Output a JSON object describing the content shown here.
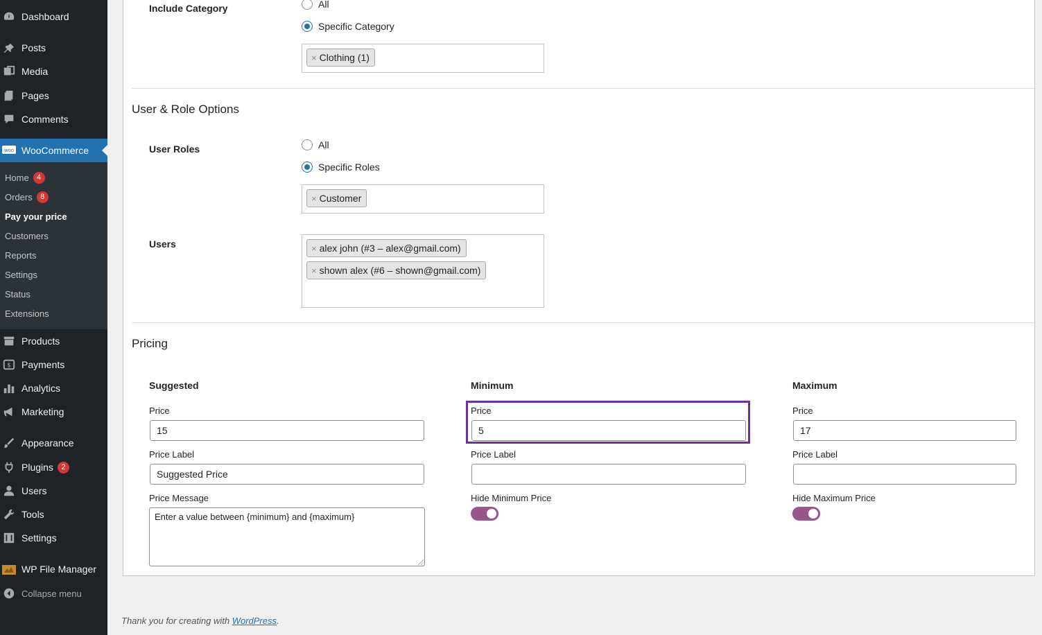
{
  "sidebar": {
    "items": [
      {
        "label": "Dashboard",
        "icon": "dashboard-icon"
      },
      {
        "label": "Posts",
        "icon": "pin-icon"
      },
      {
        "label": "Media",
        "icon": "media-icon"
      },
      {
        "label": "Pages",
        "icon": "pages-icon"
      },
      {
        "label": "Comments",
        "icon": "comment-icon"
      },
      {
        "label": "WooCommerce",
        "icon": "woo-icon"
      },
      {
        "label": "Products",
        "icon": "archive-icon"
      },
      {
        "label": "Payments",
        "icon": "payments-icon"
      },
      {
        "label": "Analytics",
        "icon": "chart-bar-icon"
      },
      {
        "label": "Marketing",
        "icon": "megaphone-icon"
      },
      {
        "label": "Appearance",
        "icon": "brush-icon"
      },
      {
        "label": "Plugins",
        "icon": "plug-icon",
        "count": "2"
      },
      {
        "label": "Users",
        "icon": "user-icon"
      },
      {
        "label": "Tools",
        "icon": "wrench-icon"
      },
      {
        "label": "Settings",
        "icon": "sliders-icon"
      },
      {
        "label": "WP File Manager",
        "icon": "folder-icon"
      },
      {
        "label": "Collapse menu",
        "icon": "collapse-icon"
      }
    ],
    "submenu": [
      {
        "label": "Home",
        "count": "4"
      },
      {
        "label": "Orders",
        "count": "8"
      },
      {
        "label": "Pay your price"
      },
      {
        "label": "Customers"
      },
      {
        "label": "Reports"
      },
      {
        "label": "Settings"
      },
      {
        "label": "Status"
      },
      {
        "label": "Extensions"
      }
    ]
  },
  "include_category": {
    "label": "Include Category",
    "option_all": "All",
    "option_specific": "Specific Category",
    "selected": "specific",
    "tokens": [
      "Clothing (1)"
    ]
  },
  "user_role": {
    "title": "User & Role Options",
    "roles_label": "User Roles",
    "option_all": "All",
    "option_specific": "Specific Roles",
    "selected": "specific",
    "role_tokens": [
      "Customer"
    ],
    "users_label": "Users",
    "user_tokens": [
      "alex john (#3 – alex@gmail.com)",
      "shown alex (#6 – shown@gmail.com)"
    ]
  },
  "pricing": {
    "title": "Pricing",
    "suggested": {
      "heading": "Suggested",
      "price_label": "Price",
      "price_value": "15",
      "price_label_label": "Price Label",
      "price_label_value": "Suggested Price",
      "message_label": "Price Message",
      "message_value": "Enter a value between {minimum} and {maximum}"
    },
    "minimum": {
      "heading": "Minimum",
      "price_label": "Price",
      "price_value": "5",
      "price_label_label": "Price Label",
      "price_label_value": "",
      "hide_label": "Hide Minimum Price",
      "hide_on": true
    },
    "maximum": {
      "heading": "Maximum",
      "price_label": "Price",
      "price_value": "17",
      "price_label_label": "Price Label",
      "price_label_value": "",
      "hide_label": "Hide Maximum Price",
      "hide_on": true
    }
  },
  "footer": {
    "text": "Thank you for creating with",
    "link": "WordPress",
    "end": "."
  },
  "colors": {
    "sidebar_bg": "#1d2327",
    "accent": "#2271b1",
    "toggle": "#96588a",
    "highlight": "#6b2fa0",
    "badge": "#d63638"
  }
}
